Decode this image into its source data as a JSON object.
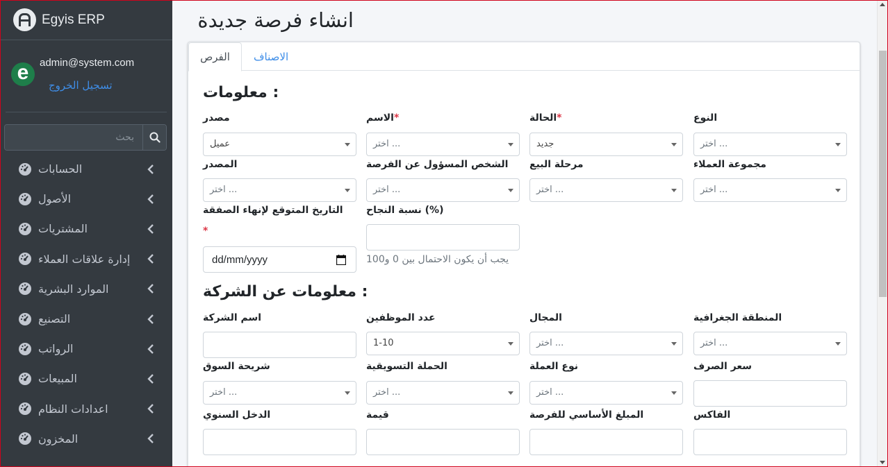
{
  "brand": {
    "name": "Egyis ERP",
    "logo_icon": "egyis-logo-icon"
  },
  "user": {
    "email": "admin@system.com",
    "logout_label": "تسجيل الخروج",
    "avatar_letter": "e"
  },
  "search": {
    "placeholder": "بحث",
    "icon": "search-icon"
  },
  "sidebar": {
    "items": [
      {
        "label": "الحسابات"
      },
      {
        "label": "الأصول"
      },
      {
        "label": "المشتريات"
      },
      {
        "label": "إدارة علاقات العملاء"
      },
      {
        "label": "الموارد البشرية"
      },
      {
        "label": "التصنيع"
      },
      {
        "label": "الرواتب"
      },
      {
        "label": "المبيعات"
      },
      {
        "label": "اعدادات النظام"
      },
      {
        "label": "المخزون"
      }
    ]
  },
  "page": {
    "title": "انشاء فرصة جديدة"
  },
  "tabs": {
    "opportunities": "الفرص",
    "categories": "الاصناف"
  },
  "section1": {
    "title": ": معلومات",
    "type_label": "النوع",
    "type_value": "... اختر",
    "status_label": "الحالة",
    "status_value": "جديد",
    "name_label": "الاسم",
    "name_value": "... اختر",
    "source_label": "مصدر",
    "source_value": "عميل",
    "customer_group_label": "مجموعة العملاء",
    "customer_group_value": "... اختر",
    "sales_stage_label": "مرحلة البيع",
    "sales_stage_value": "... اختر",
    "owner_label": "الشخص المسؤول عن الفرصة",
    "owner_value": "... اختر",
    "origin_label": "المصدر",
    "origin_value": "... اختر",
    "probability_label": "(%) نسبة النجاح",
    "probability_help": "يجب أن يكون الاحتمال بين 0 و100",
    "close_date_label": "التاريخ المتوقع لإنهاء الصفقة",
    "close_date_value": "dd/mm/yyyy",
    "required_mark": "*"
  },
  "section2": {
    "title": ": معلومات عن الشركة",
    "region_label": "المنطقة الجغرافية",
    "region_value": "... اختر",
    "industry_label": "المجال",
    "industry_value": "... اختر",
    "employees_label": "عدد الموظفين",
    "employees_value": "1-10",
    "company_label": "اسم الشركة",
    "exchange_label": "سعر الصرف",
    "currency_label": "نوع العملة",
    "currency_value": "... اختر",
    "campaign_label": "الحملة التسويقية",
    "campaign_value": "... اختر",
    "segment_label": "شريحة السوق",
    "segment_value": "... اختر",
    "fax_label": "الفاكس",
    "base_amount_label": "المبلغ الأساسي للفرصة",
    "value_label": "قيمة",
    "annual_income_label": "الدخل السنوي"
  },
  "colors": {
    "sidebar_bg": "#343a40",
    "accent": "#3f8ee8",
    "required": "#dc3545"
  }
}
